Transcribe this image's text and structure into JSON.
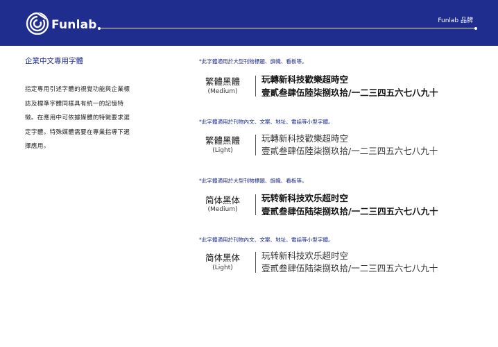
{
  "header": {
    "logo_text": "Funlab",
    "brand_label": "Funlab 品牌",
    "background": "#1f2d8f"
  },
  "section": {
    "title": "企業中文專用字體",
    "description_lines": [
      "指定專用引述字體的視覺功能與企業標",
      "誌及標準字體同樣具有統一的記憶特",
      "徵。在應用中可依據媒體的特徵要求選",
      "定字體。特殊媒體需要在專業指導下選",
      "擇應用。"
    ]
  },
  "fonts": [
    {
      "note": "*此字體適用於大型刊物標題、旗幟、看板等。",
      "name": "繁體黑體",
      "weight": "(Medium)",
      "line1": "玩轉新科技歡樂超時空",
      "line2": "壹貳叁肆伍陸柒捌玖拾/一二三四五六七八九十"
    },
    {
      "note": "*此字體適用於刊物內文、文案、地址、電話等小型字體。",
      "name": "繁體黑體",
      "weight": "(Light)",
      "line1": "玩轉新科技歡樂超時空",
      "line2": "壹貳叁肆伍陸柒捌玖拾/一二三四五六七八九十"
    },
    {
      "note": "*此字體適用於大型刊物標題、旗幟、看板等。",
      "name": "简体黑体",
      "weight": "(Medium)",
      "line1": "玩转新科技欢乐超时空",
      "line2": "壹贰叁肆伍陆柒捌玖拾/一二三四五六七八九十"
    },
    {
      "note": "*此字體適用於刊物內文、文案、地址、電話等小型字體。",
      "name": "简体黑体",
      "weight": "(Light)",
      "line1": "玩转新科技欢乐超时空",
      "line2": "壹贰叁肆伍陆柒捌玖拾/一二三四五六七八九十"
    }
  ]
}
